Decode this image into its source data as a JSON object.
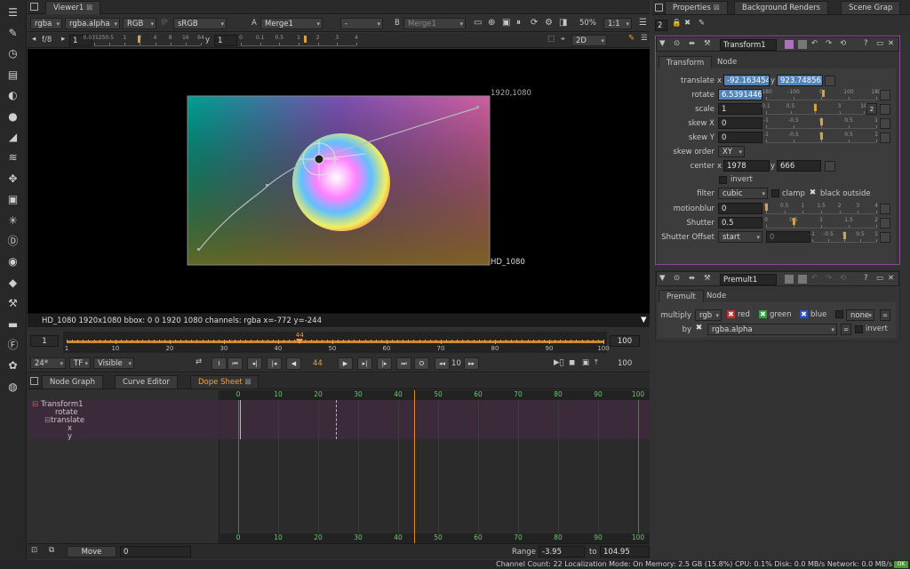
{
  "tool_icons": [
    "toolbar-menu-icon",
    "paint-icon",
    "time-icon",
    "channel-icon",
    "color-icon",
    "sphere-icon",
    "filter-icon",
    "layers-icon",
    "transform-3d-icon",
    "cube-icon",
    "particles-icon",
    "deep-icon",
    "views-icon",
    "metadata-icon",
    "toolsets-icon",
    "other-icon",
    "furnace-icon",
    "plugins-icon",
    "nuke-logo-icon"
  ],
  "viewer": {
    "tab": "Viewer1",
    "channels": "rgba",
    "alpha": "rgba.alpha",
    "display": "RGB",
    "ip": "IP",
    "lut": "sRGB",
    "a_label": "A",
    "a_input": "Merge1",
    "mid_input": "-",
    "b_label": "B",
    "b_input": "Merge1",
    "zoom": "50%",
    "ratio": "1:1",
    "fstop": "f/8",
    "frame_step": "1",
    "gain_ticks": [
      "0.03125",
      "0.5",
      "1",
      "2",
      "4",
      "8",
      "16",
      "64"
    ],
    "y_label": "y",
    "y_value": "1",
    "gamma_ticks": [
      "0",
      "0.1",
      "0.5",
      "1",
      "2",
      "3",
      "4"
    ],
    "view_mode": "2D",
    "format_top": "1920,1080",
    "format_bottom": "HD_1080",
    "info_bar": "HD_1080 1920x1080  bbox: 0 0 1920 1080 channels: rgba  x=-772 y=-244"
  },
  "timeline": {
    "start": "1",
    "end": "100",
    "current": "44",
    "end_field": "100",
    "ticks": [
      "1",
      "10",
      "20",
      "30",
      "40",
      "50",
      "60",
      "70",
      "80",
      "90",
      "100"
    ],
    "fps": "24*",
    "tf": "TF",
    "visible": "Visible",
    "frame_field": "44",
    "step": "10",
    "playback_end": "100"
  },
  "bottom_tabs": [
    "Node Graph",
    "Curve Editor",
    "Dope Sheet"
  ],
  "dope": {
    "tree": [
      "Transform1",
      "rotate",
      "translate",
      "x",
      "y"
    ],
    "ticks": [
      "0",
      "10",
      "20",
      "30",
      "40",
      "50",
      "60",
      "70",
      "80",
      "90",
      "100"
    ],
    "move_label": "Move",
    "move_value": "0",
    "range_label": "Range",
    "range_start": "-3.95",
    "to_label": "to",
    "range_end": "104.95"
  },
  "properties": {
    "tabs": [
      "Properties",
      "Background Renders",
      "Scene Grap"
    ],
    "max_panels": "2",
    "transform": {
      "name": "Transform1",
      "subtabs": [
        "Transform",
        "Node"
      ],
      "translate_label": "translate",
      "tx_label": "x",
      "tx": "-92.1634545",
      "ty_label": "y",
      "ty": "923.7485656",
      "rotate_label": "rotate",
      "rotate": "6.53914464",
      "rotate_ticks": [
        "-180",
        "-100",
        "0",
        "100",
        "180"
      ],
      "scale_label": "scale",
      "scale": "1",
      "scale_ticks": [
        "0.1",
        "0.5",
        "1",
        "3",
        "10"
      ],
      "scale_btn": "2",
      "skewx_label": "skew X",
      "skewx": "0",
      "skewy_label": "skew Y",
      "skewy": "0",
      "skew_ticks": [
        "-1",
        "-0.5",
        "0",
        "0.5",
        "1"
      ],
      "skew_order_label": "skew order",
      "skew_order": "XY",
      "center_label": "center",
      "cx_label": "x",
      "cx": "1978",
      "cy_label": "y",
      "cy": "666",
      "invert": "invert",
      "filter_label": "filter",
      "filter": "cubic",
      "clamp": "clamp",
      "black_outside": "black outside",
      "motionblur_label": "motionblur",
      "motionblur": "0",
      "motionblur_ticks": [
        "0",
        "0.5",
        "1",
        "1.5",
        "2",
        "3",
        "4"
      ],
      "shutter_label": "Shutter",
      "shutter": "0.5",
      "shutter_ticks": [
        "0",
        "0.5",
        "1",
        "1.5",
        "2"
      ],
      "shutter_offset_label": "Shutter Offset",
      "shutter_offset": "start",
      "shutter_custom": "0",
      "shutter_custom_ticks": [
        "-1",
        "-0.5",
        "0",
        "0.5",
        "1"
      ]
    },
    "premult": {
      "name": "Premult1",
      "subtabs": [
        "Premult",
        "Node"
      ],
      "multiply_label": "multiply",
      "multiply": "rgb",
      "red": "red",
      "green": "green",
      "blue": "blue",
      "none": "none",
      "by_label": "by",
      "by": "rgba.alpha",
      "invert": "invert"
    }
  },
  "status": {
    "text": "Channel Count: 22  Localization Mode: On  Memory: 2.5 GB (15.8%)  CPU: 0.1%  Disk: 0.0 MB/s  Network: 0.0 MB/s",
    "ok": "OK"
  }
}
